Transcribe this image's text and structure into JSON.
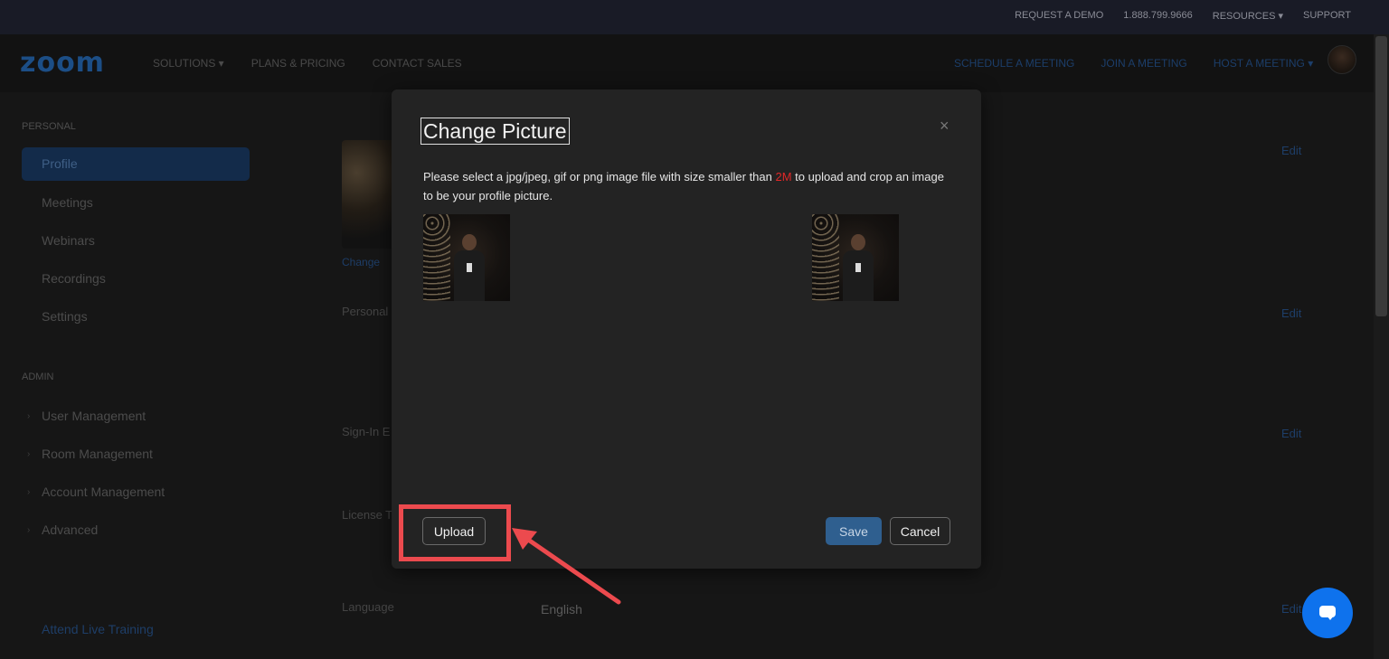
{
  "topbar": {
    "links": [
      "REQUEST A DEMO",
      "1.888.799.9666",
      "RESOURCES ▾",
      "SUPPORT"
    ]
  },
  "nav": {
    "logo": "zoom",
    "left_links": [
      "SOLUTIONS ▾",
      "PLANS & PRICING",
      "CONTACT SALES"
    ],
    "right_links": [
      "SCHEDULE A MEETING",
      "JOIN A MEETING",
      "HOST A MEETING ▾"
    ]
  },
  "sidebar": {
    "personal_heading": "PERSONAL",
    "personal_items": [
      "Profile",
      "Meetings",
      "Webinars",
      "Recordings",
      "Settings"
    ],
    "active_item": "Profile",
    "admin_heading": "ADMIN",
    "admin_items": [
      "User Management",
      "Room Management",
      "Account Management",
      "Advanced"
    ],
    "footer_link": "Attend Live Training"
  },
  "main": {
    "change_link": "Change",
    "labels": [
      "Personal",
      "Sign-In E",
      "License T",
      "Language"
    ],
    "language_value": "English",
    "edit_label": "Edit"
  },
  "modal": {
    "title": "Change Picture",
    "close_icon": "×",
    "desc_before": "Please select a jpg/jpeg, gif or png image file with size smaller than ",
    "desc_size": "2M",
    "desc_after": " to upload and crop an image to be your profile picture.",
    "upload_label": "Upload",
    "save_label": "Save",
    "cancel_label": "Cancel"
  },
  "colors": {
    "annotation": "#ec4a4e",
    "accent": "#0e72ed",
    "size_highlight": "#e02828"
  }
}
